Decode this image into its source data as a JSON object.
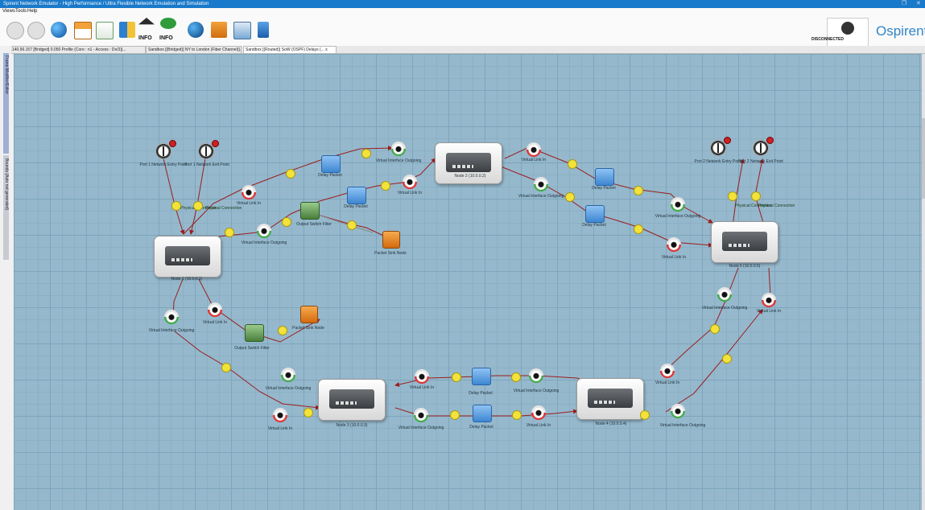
{
  "window": {
    "title": "Spirent Network Emulator - High Performance / Ultra Flexible Network Emulation and Simulation"
  },
  "menu": [
    {
      "label": "Views"
    },
    {
      "label": "Tools"
    },
    {
      "label": "Help"
    }
  ],
  "toolbar": {
    "info_label_1": "INFO",
    "info_label_2": "INFO",
    "connection_status": "DISCONNECTED",
    "brand": "Ospirent"
  },
  "tabs": [
    {
      "label": "10.140.96.157 [Bridged] 0.050 Profile (Core : n1 - Access : Dx/3)]..."
    },
    {
      "label": "Sandbox [(Bridged)] NY to London (Fiber Channel)]..."
    },
    {
      "label": "Sandbox [(Routed)] SoW (OSPF) Delays (... x"
    }
  ],
  "side_panels": {
    "upper": "Frame Modifier/Editor",
    "lower": "Bounds (Auto not generated)"
  },
  "diagram": {
    "nodes": [
      {
        "label": "Node 1 (10.0.0.1)"
      },
      {
        "label": "Node 2 (10.0.0.2)"
      },
      {
        "label": "Node 3 (10.0.0.3)"
      },
      {
        "label": "Node 4 (10.0.0.4)"
      },
      {
        "label": "Node 5 (10.0.0.5)"
      }
    ],
    "endpoints": [
      {
        "label": "Port 1 Network Entry Point"
      },
      {
        "label": "Port 1 Network Exit Point"
      },
      {
        "label": "Port 2 Network Entry Point"
      },
      {
        "label": "Port 2 Network Exit Point"
      }
    ],
    "delay_label": "Delay Packet",
    "switch_label": "Output Switch Filter",
    "sink_label": "Packet Sink Node",
    "vi_out_label": "Virtual Interface Outgoing",
    "vi_in_label": "Virtual Link In",
    "connection_label": "Physical Connection"
  }
}
